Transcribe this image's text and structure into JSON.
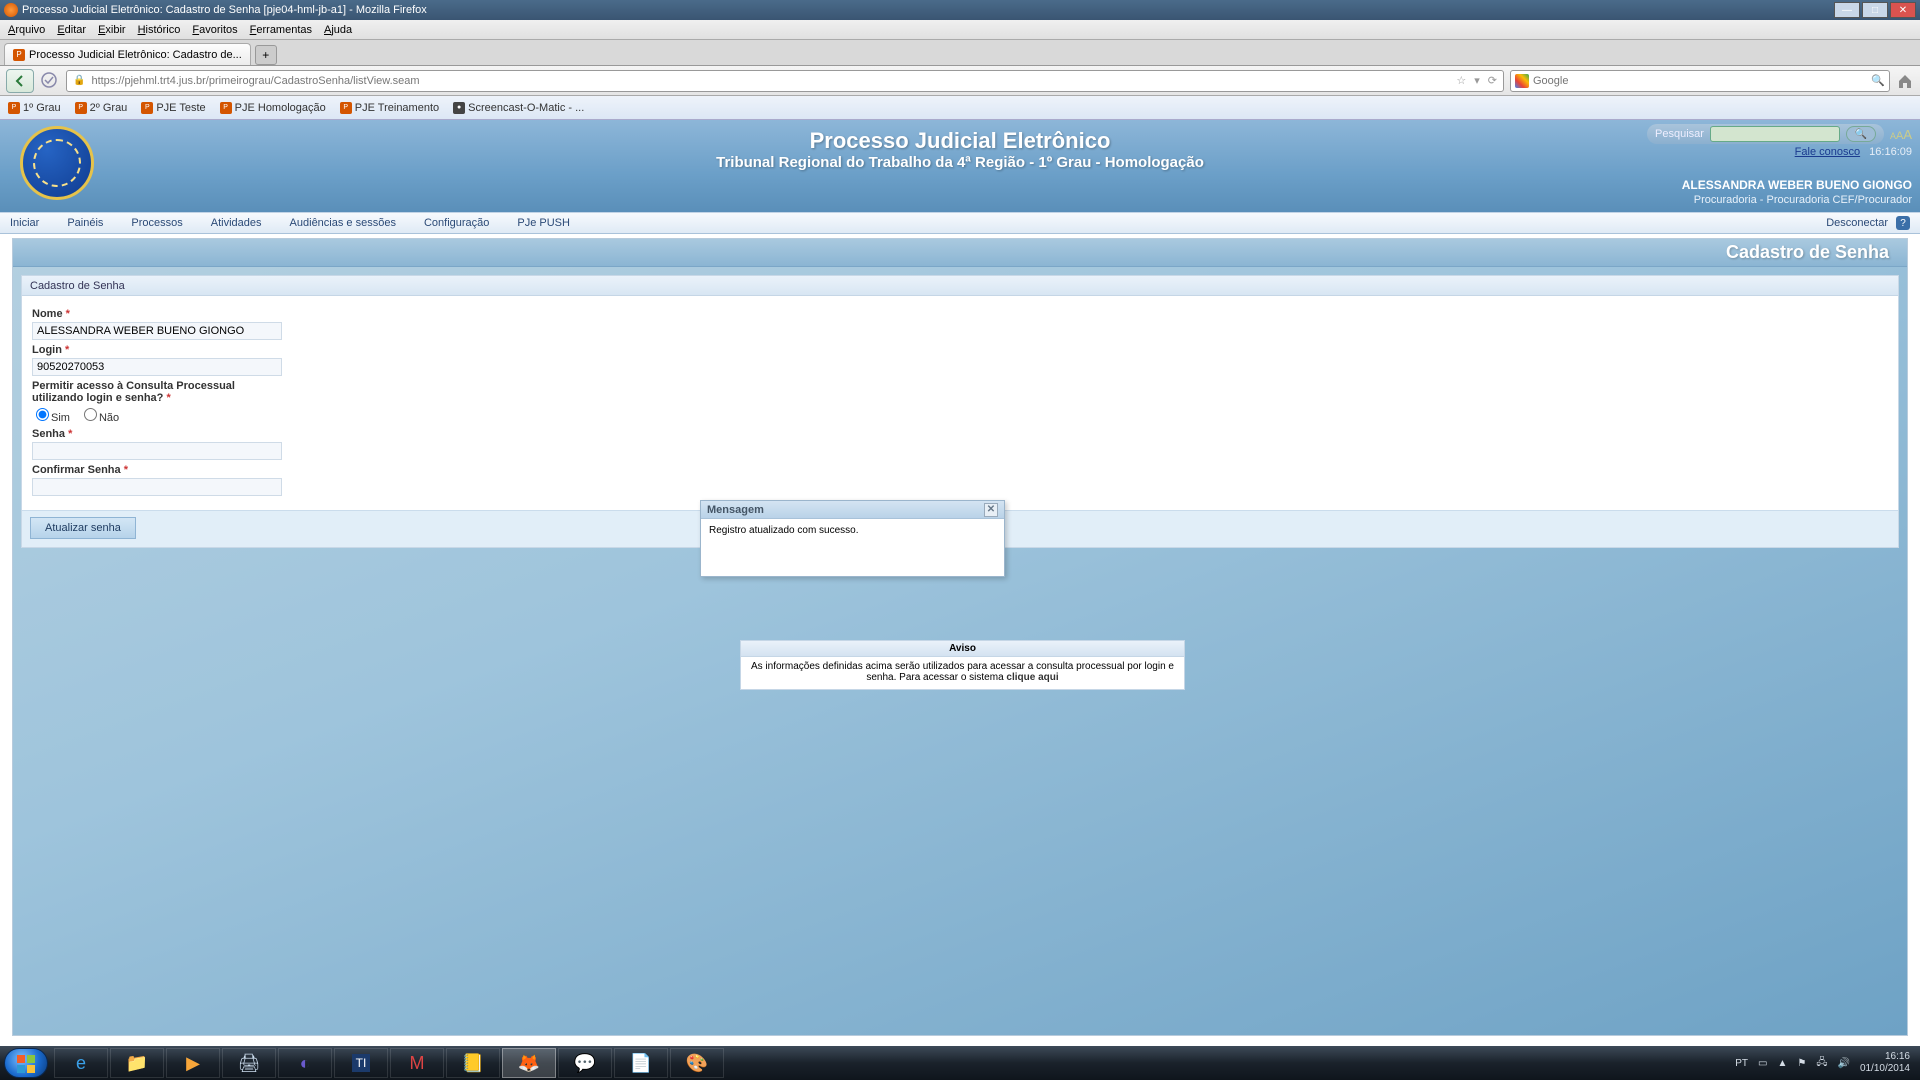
{
  "window": {
    "title": "Processo Judicial Eletrônico: Cadastro de Senha  [pje04-hml-jb-a1] - Mozilla Firefox"
  },
  "menubar": [
    "Arquivo",
    "Editar",
    "Exibir",
    "Histórico",
    "Favoritos",
    "Ferramentas",
    "Ajuda"
  ],
  "tab": {
    "label": "Processo Judicial Eletrônico: Cadastro de..."
  },
  "url": "https://pjehml.trt4.jus.br/primeirograu/CadastroSenha/listView.seam",
  "search_engine_placeholder": "Google",
  "bookmarks": [
    {
      "label": "1º Grau",
      "ico": "PJe"
    },
    {
      "label": "2º Grau",
      "ico": "PJe"
    },
    {
      "label": "PJE Teste",
      "ico": "PJe"
    },
    {
      "label": "PJE Homologação",
      "ico": "PJe"
    },
    {
      "label": "PJE Treinamento",
      "ico": "PJe"
    },
    {
      "label": "Screencast-O-Matic - ...",
      "ico": "rec"
    }
  ],
  "app": {
    "title": "Processo Judicial Eletrônico",
    "subtitle": "Tribunal Regional do Trabalho da 4ª Região - 1º Grau - Homologação",
    "search_label": "Pesquisar",
    "fale": "Fale conosco",
    "clock": "16:16:09",
    "user_name": "ALESSANDRA WEBER BUENO GIONGO",
    "user_role": "Procuradoria - Procuradoria CEF/Procurador"
  },
  "nav": {
    "items": [
      "Iniciar",
      "Painéis",
      "Processos",
      "Atividades",
      "Audiências e sessões",
      "Configuração",
      "PJe PUSH"
    ],
    "disconnect": "Desconectar"
  },
  "page": {
    "banner": "Cadastro de Senha",
    "panel_title": "Cadastro de Senha"
  },
  "form": {
    "nome_label": "Nome",
    "nome_value": "ALESSANDRA WEBER BUENO GIONGO",
    "login_label": "Login",
    "login_value": "90520270053",
    "permitir_label": "Permitir acesso à Consulta Processual utilizando login e senha?",
    "sim": "Sim",
    "nao": "Não",
    "senha_label": "Senha",
    "confirmar_label": "Confirmar Senha",
    "submit": "Atualizar senha"
  },
  "message": {
    "title": "Mensagem",
    "body": "Registro atualizado com sucesso."
  },
  "aviso": {
    "title": "Aviso",
    "body": "As informações definidas acima serão utilizados para acessar a consulta processual por login e senha. Para acessar o sistema ",
    "link": "clique aqui"
  },
  "taskbar": {
    "lang": "PT",
    "time": "16:16",
    "date": "01/10/2014"
  }
}
